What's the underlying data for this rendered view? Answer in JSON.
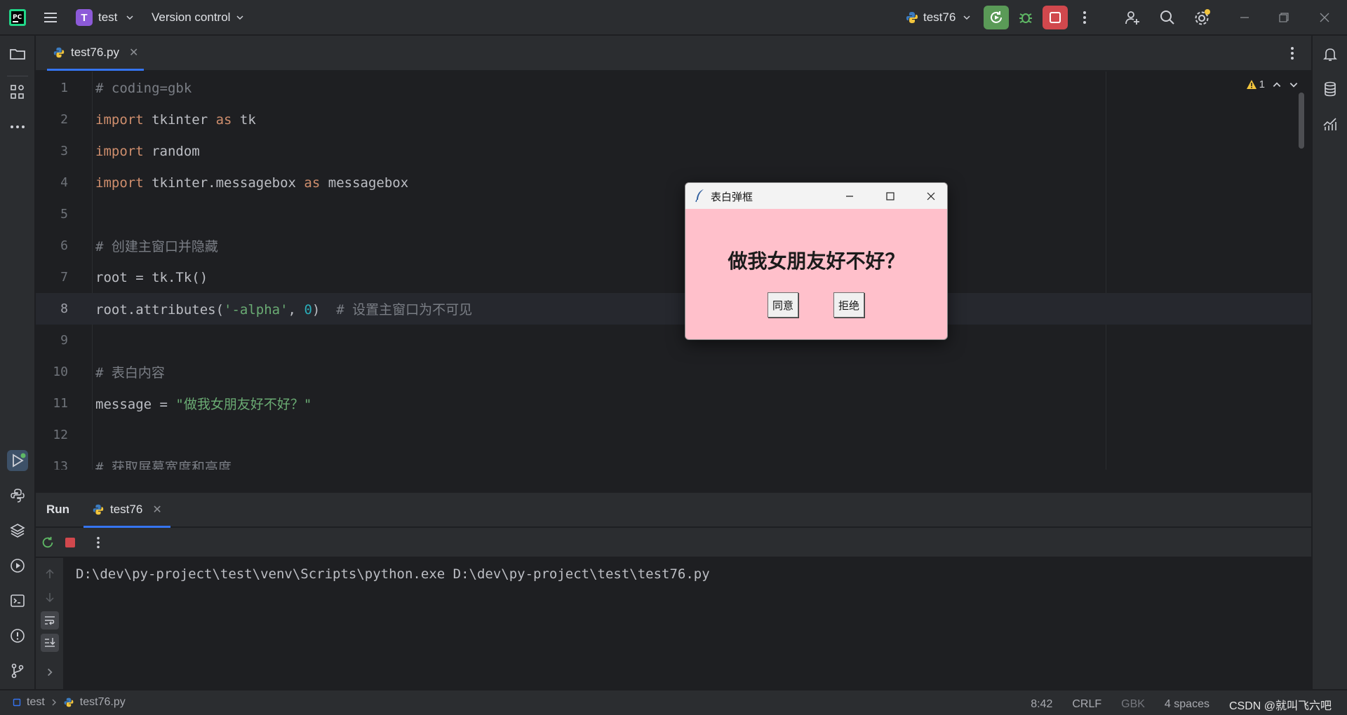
{
  "titlebar": {
    "project_badge": "T",
    "project_name": "test",
    "vcs_label": "Version control",
    "run_config": "test76"
  },
  "editor": {
    "tab_label": "test76.py",
    "warning_count": "1",
    "lines": [
      {
        "n": "1",
        "tokens": [
          {
            "t": "cmt",
            "v": "# coding=gbk"
          }
        ]
      },
      {
        "n": "2",
        "tokens": [
          {
            "t": "kw",
            "v": "import"
          },
          {
            "t": "plain",
            "v": " tkinter "
          },
          {
            "t": "kw",
            "v": "as"
          },
          {
            "t": "plain",
            "v": " tk"
          }
        ]
      },
      {
        "n": "3",
        "tokens": [
          {
            "t": "kw",
            "v": "import"
          },
          {
            "t": "plain",
            "v": " random"
          }
        ]
      },
      {
        "n": "4",
        "tokens": [
          {
            "t": "kw",
            "v": "import"
          },
          {
            "t": "plain",
            "v": " tkinter.messagebox "
          },
          {
            "t": "kw",
            "v": "as"
          },
          {
            "t": "plain",
            "v": " messagebox"
          }
        ]
      },
      {
        "n": "5",
        "tokens": []
      },
      {
        "n": "6",
        "tokens": [
          {
            "t": "cmt",
            "v": "# 创建主窗口并隐藏"
          }
        ]
      },
      {
        "n": "7",
        "tokens": [
          {
            "t": "plain",
            "v": "root = tk.Tk()"
          }
        ]
      },
      {
        "n": "8",
        "current": true,
        "tokens": [
          {
            "t": "plain",
            "v": "root.attributes("
          },
          {
            "t": "str",
            "v": "'-alpha'"
          },
          {
            "t": "plain",
            "v": ", "
          },
          {
            "t": "num",
            "v": "0"
          },
          {
            "t": "plain",
            "v": ")  "
          },
          {
            "t": "cmt",
            "v": "# 设置主窗口为不可见"
          }
        ]
      },
      {
        "n": "9",
        "tokens": []
      },
      {
        "n": "10",
        "tokens": [
          {
            "t": "cmt",
            "v": "# 表白内容"
          }
        ]
      },
      {
        "n": "11",
        "tokens": [
          {
            "t": "plain",
            "v": "message = "
          },
          {
            "t": "str",
            "v": "\"做我女朋友好不好？\""
          }
        ]
      },
      {
        "n": "12",
        "tokens": []
      },
      {
        "n": "13",
        "tokens": [
          {
            "t": "cmt",
            "v": "# 获取屏幕宽度和高度"
          }
        ]
      }
    ]
  },
  "run_panel": {
    "title": "Run",
    "tab_label": "test76",
    "console_output": "D:\\dev\\py-project\\test\\venv\\Scripts\\python.exe D:\\dev\\py-project\\test\\test76.py"
  },
  "statusbar": {
    "breadcrumb_project": "test",
    "breadcrumb_file": "test76.py",
    "position": "8:42",
    "line_ending": "CRLF",
    "encoding": "GBK",
    "indent": "4 spaces",
    "watermark": "CSDN @就叫飞六吧"
  },
  "dialog": {
    "title": "表白弹框",
    "message": "做我女朋友好不好？",
    "agree_label": "同意",
    "refuse_label": "拒绝",
    "background_color": "#ffc0cb"
  },
  "colors": {
    "ide_background": "#1e1f22",
    "panel_background": "#2b2d30",
    "accent": "#3574f0",
    "run_button": "#5a9a57",
    "stop_button": "#d1484d"
  }
}
